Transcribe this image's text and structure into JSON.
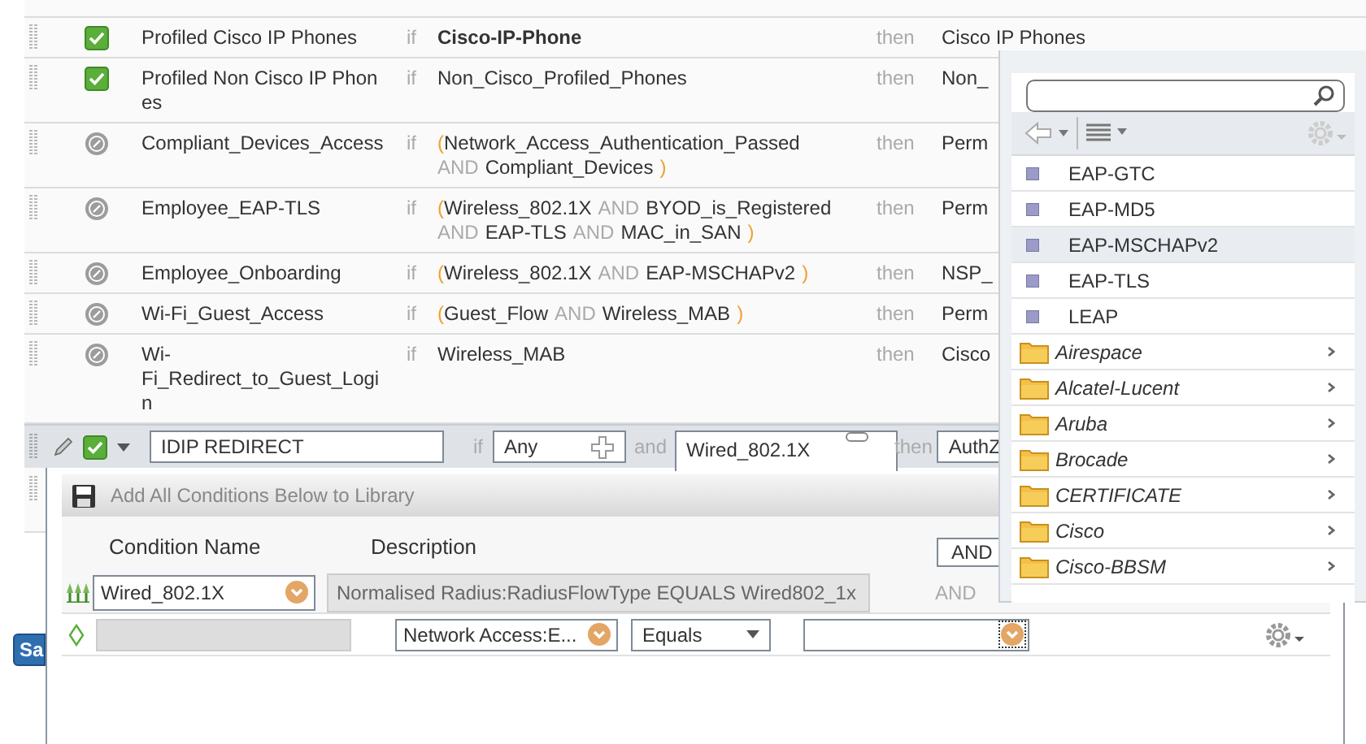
{
  "rules": [
    {
      "enabled": true,
      "name_lines": [
        "Profiled Cisco IP Phones"
      ],
      "if": "if",
      "condition_lines": [
        [
          {
            "kind": "bold",
            "text": "Cisco-IP-Phone"
          }
        ]
      ],
      "then": "then",
      "result": "Cisco IP Phones"
    },
    {
      "enabled": true,
      "name_lines": [
        "Profiled Non Cisco IP Phon",
        "es"
      ],
      "if": "if",
      "condition_lines": [
        [
          {
            "kind": "term",
            "text": "Non_Cisco_Profiled_Phones"
          }
        ]
      ],
      "then": "then",
      "result": "Non_"
    },
    {
      "enabled": false,
      "name_lines": [
        "Compliant_Devices_Access"
      ],
      "if": "if",
      "condition_lines": [
        [
          {
            "kind": "open",
            "text": "("
          },
          {
            "kind": "term",
            "text": "Network_Access_Authentication_Passed"
          }
        ],
        [
          {
            "kind": "op",
            "text": "AND"
          },
          {
            "kind": "term",
            "text": "Compliant_Devices"
          },
          {
            "kind": "close",
            "text": ")"
          }
        ]
      ],
      "then": "then",
      "result": "Perm"
    },
    {
      "enabled": false,
      "name_lines": [
        "Employee_EAP-TLS"
      ],
      "if": "if",
      "condition_lines": [
        [
          {
            "kind": "open",
            "text": "("
          },
          {
            "kind": "term",
            "text": "Wireless_802.1X"
          },
          {
            "kind": "op",
            "text": "AND"
          },
          {
            "kind": "term",
            "text": "BYOD_is_Registered"
          }
        ],
        [
          {
            "kind": "op",
            "text": "AND"
          },
          {
            "kind": "term",
            "text": "EAP-TLS"
          },
          {
            "kind": "op",
            "text": "AND"
          },
          {
            "kind": "term",
            "text": "MAC_in_SAN"
          },
          {
            "kind": "close",
            "text": ")"
          }
        ]
      ],
      "then": "then",
      "result": "Perm"
    },
    {
      "enabled": false,
      "name_lines": [
        "Employee_Onboarding"
      ],
      "if": "if",
      "condition_lines": [
        [
          {
            "kind": "open",
            "text": "("
          },
          {
            "kind": "term",
            "text": "Wireless_802.1X"
          },
          {
            "kind": "op",
            "text": "AND"
          },
          {
            "kind": "term",
            "text": "EAP-MSCHAPv2"
          },
          {
            "kind": "close",
            "text": ")"
          }
        ]
      ],
      "then": "then",
      "result": "NSP_"
    },
    {
      "enabled": false,
      "name_lines": [
        "Wi-Fi_Guest_Access"
      ],
      "if": "if",
      "condition_lines": [
        [
          {
            "kind": "open",
            "text": "("
          },
          {
            "kind": "term",
            "text": "Guest_Flow"
          },
          {
            "kind": "op",
            "text": "AND"
          },
          {
            "kind": "term",
            "text": "Wireless_MAB"
          },
          {
            "kind": "close",
            "text": ")"
          }
        ]
      ],
      "then": "then",
      "result": "Perm"
    },
    {
      "enabled": false,
      "name_lines": [
        "Wi-",
        "Fi_Redirect_to_Guest_Logi",
        "n"
      ],
      "if": "if",
      "condition_lines": [
        [
          {
            "kind": "term",
            "text": "Wireless_MAB"
          }
        ]
      ],
      "then": "then",
      "result": "Cisco"
    }
  ],
  "edit_row": {
    "enabled": true,
    "name": "IDIP REDIRECT",
    "if": "if",
    "first_condition": "Any",
    "and": "and",
    "second_condition": "Wired_802.1X",
    "then": "then",
    "result": "AuthZ"
  },
  "save_button": "Sa",
  "condition_panel": {
    "toolbar_label": "Add All Conditions Below to Library",
    "columns": [
      "Condition Name",
      "Description"
    ],
    "operator_select": "AND",
    "library_condition": {
      "name": "Wired_802.1X",
      "description": "Normalised Radius:RadiusFlowType EQUALS Wired802_1x",
      "operator": "AND"
    },
    "new_condition": {
      "attribute": "Network Access:E...",
      "comparison": "Equals"
    }
  },
  "dictionary_dropdown": {
    "items": [
      {
        "kind": "attribute",
        "label": "EAP-GTC",
        "selected": false
      },
      {
        "kind": "attribute",
        "label": "EAP-MD5",
        "selected": false
      },
      {
        "kind": "attribute",
        "label": "EAP-MSCHAPv2",
        "selected": true
      },
      {
        "kind": "attribute",
        "label": "EAP-TLS",
        "selected": false
      },
      {
        "kind": "attribute",
        "label": "LEAP",
        "selected": false
      },
      {
        "kind": "folder",
        "label": "Airespace",
        "selected": false
      },
      {
        "kind": "folder",
        "label": "Alcatel-Lucent",
        "selected": false
      },
      {
        "kind": "folder",
        "label": "Aruba",
        "selected": false
      },
      {
        "kind": "folder",
        "label": "Brocade",
        "selected": false
      },
      {
        "kind": "folder",
        "label": "CERTIFICATE",
        "selected": false
      },
      {
        "kind": "folder",
        "label": "Cisco",
        "selected": false
      },
      {
        "kind": "folder",
        "label": "Cisco-BBSM",
        "selected": false
      }
    ]
  }
}
